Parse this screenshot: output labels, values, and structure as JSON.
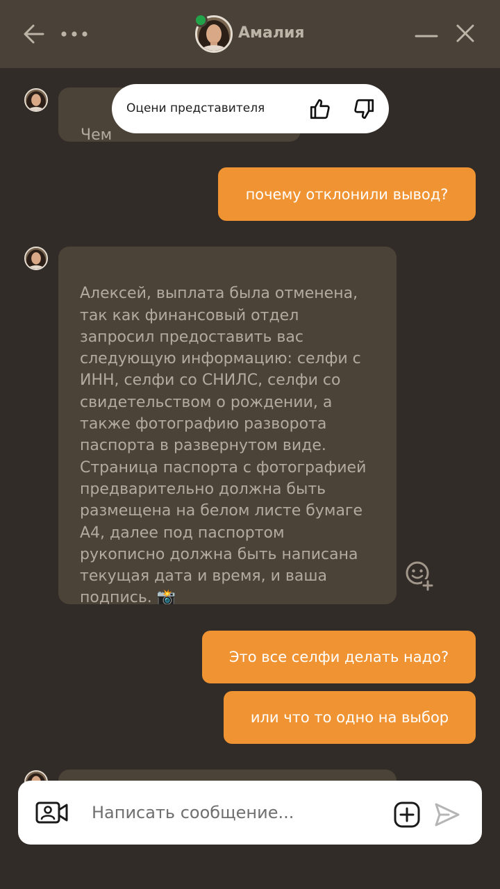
{
  "header": {
    "agent_name": "Амалия",
    "status": "online",
    "back_icon": "arrow-left-icon",
    "menu_icon": "ellipsis-icon",
    "minimize_icon": "minimize-icon",
    "close_icon": "close-icon"
  },
  "rating_popup": {
    "label": "Оцени представителя",
    "like_icon": "thumbs-up-icon",
    "dislike_icon": "thumbs-down-icon"
  },
  "messages": [
    {
      "from": "agent",
      "text": "Чем"
    },
    {
      "from": "user",
      "text": "почему отклонили вывод?"
    },
    {
      "from": "agent",
      "text": "Алексей, выплата была отменена,\nтак как финансовый отдел\nзапросил предоставить вас\nследующую информацию: селфи с\nИНН, селфи со СНИЛС, селфи со\nсвидетельством о рождении, а\nтакже фотографию разворота\nпаспорта в развернутом виде.\nСтраница паспорта с фотографией\nпредварительно должна быть\nразмещена на белом листе бумаге\nА4, далее под паспортом\nрукописно должна быть написана\nтекущая дата и время, и ваша\nподпись. 📸"
    },
    {
      "from": "user",
      "text": "Это все селфи делать надо?"
    },
    {
      "from": "user",
      "text": "или что то одно на выбор"
    }
  ],
  "composer": {
    "placeholder": "Написать сообщение...",
    "video_icon": "video-call-icon",
    "attach_icon": "add-square-icon",
    "send_icon": "send-icon"
  },
  "colors": {
    "background": "#312c28",
    "header": "#4a4238",
    "agent_bubble": "#4b4338",
    "user_bubble": "#f09433"
  }
}
